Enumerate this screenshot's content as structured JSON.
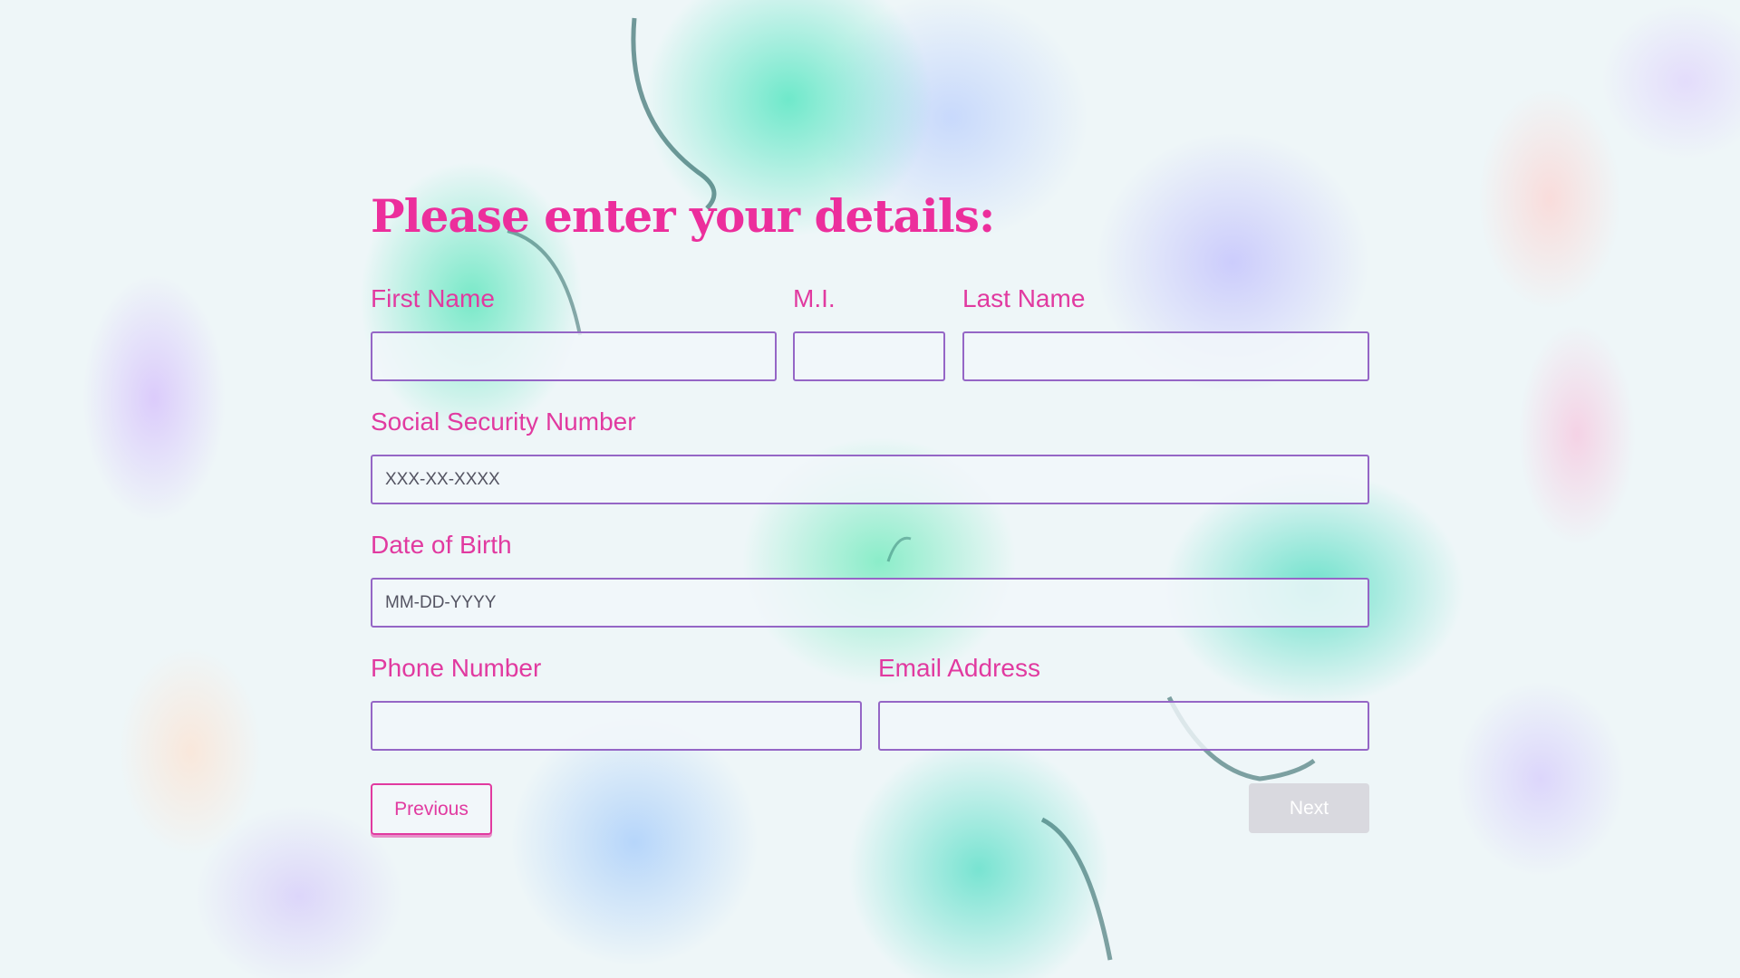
{
  "form": {
    "heading": "Please enter your details:",
    "fields": {
      "first_name": {
        "label": "First Name",
        "value": "",
        "placeholder": ""
      },
      "middle_initial": {
        "label": "M.I.",
        "value": "",
        "placeholder": ""
      },
      "last_name": {
        "label": "Last Name",
        "value": "",
        "placeholder": ""
      },
      "ssn": {
        "label": "Social Security Number",
        "value": "",
        "placeholder": "XXX-XX-XXXX"
      },
      "dob": {
        "label": "Date of Birth",
        "value": "",
        "placeholder": "MM-DD-YYYY"
      },
      "phone": {
        "label": "Phone Number",
        "value": "",
        "placeholder": ""
      },
      "email": {
        "label": "Email Address",
        "value": "",
        "placeholder": ""
      }
    },
    "buttons": {
      "previous": "Previous",
      "next": "Next"
    }
  },
  "theme": {
    "accent": "#e13aa0",
    "heading_color": "#ec2e9c",
    "field_border": "#9566c6",
    "next_disabled_bg": "#d6d6dc"
  }
}
